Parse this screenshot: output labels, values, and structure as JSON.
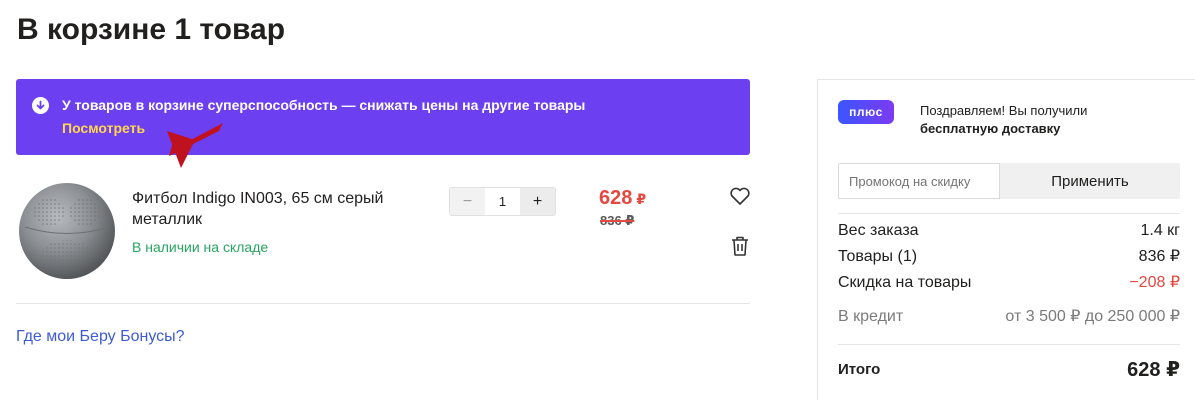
{
  "header": {
    "title": "В корзине 1 товар"
  },
  "promo_banner": {
    "icon": "arrow-down-circle-icon",
    "text": "У товаров в корзине суперспособность — снижать цены на другие товары",
    "link": "Посмотреть",
    "color": "#6c3ff0",
    "link_color": "#ffd84a"
  },
  "annotation": {
    "arrow_color": "#c0111f"
  },
  "cart_item": {
    "name": "Фитбол Indigo IN003, 65 см серый металлик",
    "stock": "В наличии на складе",
    "quantity": "1",
    "minus": "−",
    "plus": "+",
    "price_current": "628",
    "price_old": "836 ₽",
    "currency": "₽",
    "favorite_icon": "heart-icon",
    "delete_icon": "trash-icon"
  },
  "bonus_link": "Где мои Беру Бонусы?",
  "summary": {
    "plus_badge": "плюс",
    "plus_line1": "Поздравляем! Вы получили",
    "plus_line2": "бесплатную доставку",
    "promo_placeholder": "Промокод на скидку",
    "apply_button": "Применить",
    "rows": [
      {
        "label": "Вес заказа",
        "value": "1.4 кг"
      },
      {
        "label": "Товары (1)",
        "value": "836 ₽"
      },
      {
        "label": "Скидка на товары",
        "value": "−208 ₽"
      },
      {
        "label": "В кредит",
        "value": "от 3 500 ₽  до 250 000 ₽"
      }
    ],
    "total_label": "Итого",
    "total_value": "628 ₽"
  }
}
